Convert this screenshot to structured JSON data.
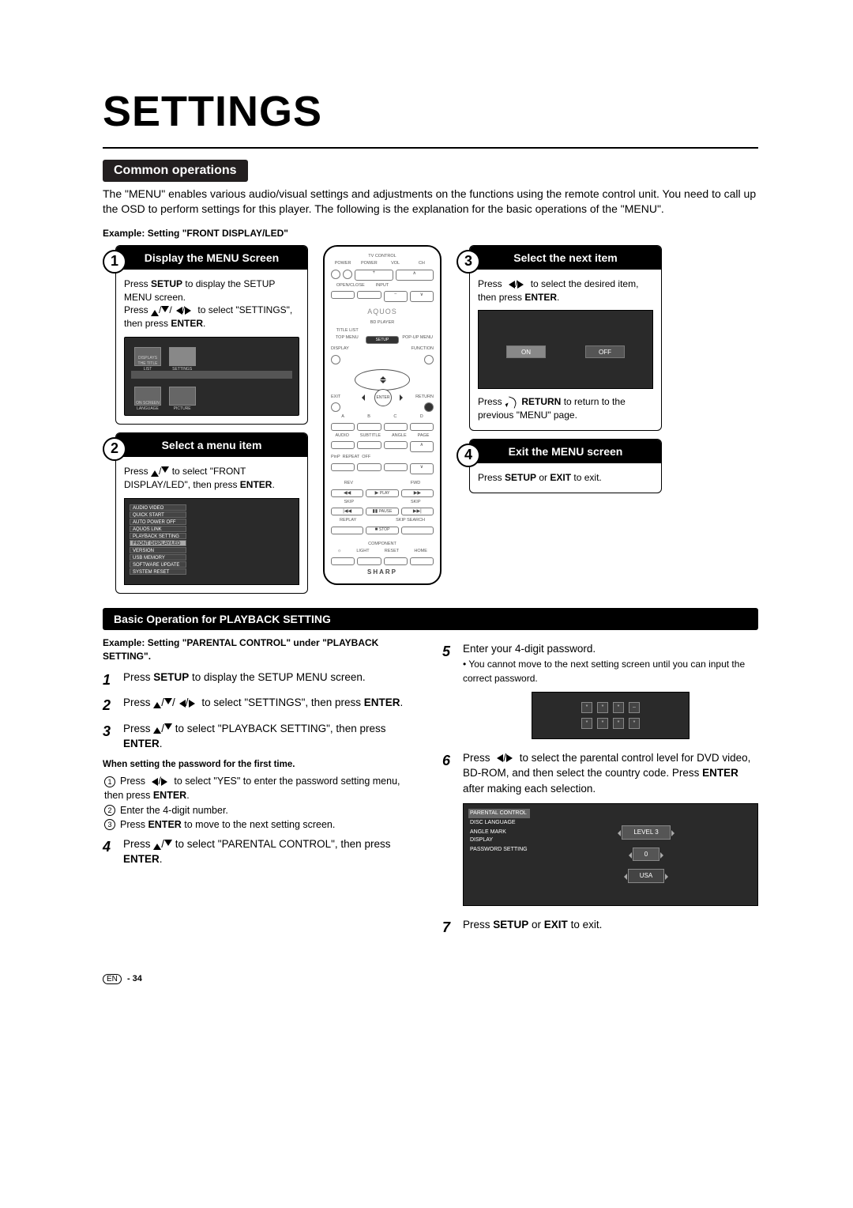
{
  "title": "SETTINGS",
  "section_common": "Common operations",
  "intro": "The \"MENU\" enables various audio/visual settings and adjustments on the functions using the remote control unit. You need to call up the OSD to perform settings for this player. The following is the explanation for the basic operations of the \"MENU\".",
  "example_top": "Example: Setting \"FRONT DISPLAY/LED\"",
  "step1": {
    "num": "1",
    "header": "Display the MENU Screen",
    "line1a": "Press ",
    "line1b": "SETUP",
    "line1c": " to display the SETUP MENU screen.",
    "line2a": "Press ",
    "line2b": " to select \"SETTINGS\", then press ",
    "line2c": "ENTER",
    "tiles": {
      "t1": "DISPLAYS THE TITLE LIST",
      "t2": "SETTINGS",
      "t3": "ON SCREEN LANGUAGE",
      "t4": "PICTURE"
    }
  },
  "step2": {
    "num": "2",
    "header": "Select a menu item",
    "line1a": "Press ",
    "line1b": " to select \"FRONT DISPLAY/LED\", then press ",
    "line1c": "ENTER",
    "list": [
      "AUDIO VIDEO SETTINGS",
      "QUICK START",
      "AUTO POWER OFF",
      "AQUOS LINK",
      "PLAYBACK SETTING",
      "FRONT DISPLAY/LED",
      "VERSION",
      "USB MEMORY MANAGEMENT",
      "SOFTWARE UPDATE",
      "SYSTEM RESET"
    ],
    "sel_index": 5
  },
  "step3": {
    "num": "3",
    "header": "Select the next item",
    "line1a": "Press ",
    "line1b": " to select the desired item, then press ",
    "line1c": "ENTER",
    "on": "ON",
    "off": "OFF",
    "retline_a": "Press ",
    "retline_b": " RETURN",
    "retline_c": " to return to the previous \"MENU\" page."
  },
  "step4": {
    "num": "4",
    "header": "Exit the MENU screen",
    "line_a": "Press ",
    "line_b": "SETUP",
    "line_c": " or ",
    "line_d": "EXIT",
    "line_e": " to exit."
  },
  "remote": {
    "tv_control": "TV CONTROL",
    "power": "POWER",
    "vol": "VOL",
    "ch": "CH",
    "openclose": "OPEN/CLOSE",
    "input": "INPUT",
    "aquos": "AQUOS",
    "bd": "BD PLAYER",
    "titlelist": "TITLE LIST",
    "topmenu": "TOP MENU",
    "setup": "SETUP",
    "popup": "POP-UP MENU",
    "display": "DISPLAY",
    "function": "FUNCTION",
    "enter": "ENTER",
    "exit": "EXIT",
    "return": "RETURN",
    "a": "A",
    "b": "B",
    "c": "C",
    "d": "D",
    "audio": "AUDIO",
    "subtitle": "SUBTITLE",
    "angle": "ANGLE",
    "page": "PAGE",
    "pinp": "PinP",
    "repeat": "REPEAT",
    "off": "OFF",
    "rev": "REV",
    "play": "PLAY",
    "fwd": "FWD",
    "skip": "SKIP",
    "pause": "PAUSE",
    "replay": "REPLAY",
    "stop": "STOP",
    "skipsearch": "SKIP SEARCH",
    "component": "COMPONENT",
    "light": "LIGHT",
    "reset": "RESET",
    "home": "HOME",
    "brand": "SHARP"
  },
  "playback_header": "Basic Operation for PLAYBACK SETTING",
  "playback_example": "Example: Setting \"PARENTAL CONTROL\" under \"PLAYBACK SETTING\".",
  "p1_a": "Press ",
  "p1_b": "SETUP",
  "p1_c": " to display the SETUP MENU screen.",
  "p2_a": "Press ",
  "p2_b": " to select \"SETTINGS\", then press ",
  "p2_c": "ENTER",
  "p2_d": ".",
  "p3_a": "Press ",
  "p3_b": " to select \"PLAYBACK SETTING\", then press ",
  "p3_c": "ENTER",
  "p3_d": ".",
  "pw_note": "When setting the password for the first time.",
  "pw_1": "Press ",
  "pw_1b": " to select \"YES\" to enter the password setting menu, then press ",
  "pw_1c": "ENTER",
  "pw_1d": ".",
  "pw_2": "Enter the 4-digit number.",
  "pw_3a": "Press ",
  "pw_3b": "ENTER",
  "pw_3c": " to move to the next setting screen.",
  "p4_a": "Press ",
  "p4_b": " to select \"PARENTAL CONTROL\", then press ",
  "p4_c": "ENTER",
  "p4_d": ".",
  "p5": "Enter your 4-digit password.",
  "p5_note": "You cannot move to the next setting screen until you can input the correct password.",
  "p6_a": "Press ",
  "p6_b": " to select the parental control level for DVD video, BD-ROM, and then select the country code. Press ",
  "p6_c": "ENTER",
  "p6_d": " after making each selection.",
  "parental": {
    "menu": [
      "PARENTAL CONTROL",
      "DISC LANGUAGE",
      "ANGLE MARK DISPLAY",
      "PASSWORD SETTING"
    ],
    "level": "LEVEL 3",
    "zero": "0",
    "usa": "USA"
  },
  "p7_a": "Press ",
  "p7_b": "SETUP",
  "p7_c": " or ",
  "p7_d": "EXIT",
  "p7_e": " to exit.",
  "footer_en": "EN",
  "footer_page": " - 34"
}
